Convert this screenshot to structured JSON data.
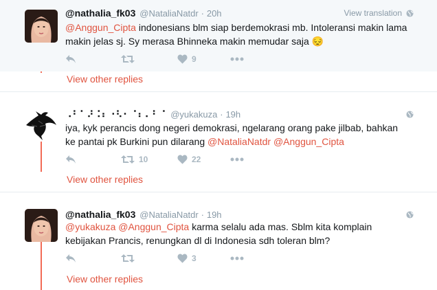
{
  "tweets": [
    {
      "fullname": "@nathalia_fk03",
      "screen_name": "@NataliaNatdr",
      "separator": "·",
      "time": "20h",
      "view_translation": "View translation",
      "text_parts": [
        "@Anggun_Cipta",
        " indonesians blm siap berdemokrasi mb. Intoleransi makin lama",
        "makin jelas sj. Sy merasa Bhinneka makin memudar saja ",
        "😔"
      ],
      "retweets": "",
      "likes": "9",
      "more_replies": "View other replies"
    },
    {
      "fullname": "⠠⠃⠁⠜⠨⠆⠐⠣⠂⠈⠆⠄⠃⠈",
      "screen_name": "@yukakuza",
      "separator": "·",
      "time": "19h",
      "text_line1": "iya, kyk perancis dong negeri demokrasi, ngelarang orang pake jilbab, bahkan",
      "text_line2_plain": "ke pantai pk Burkini pun dilarang ",
      "mention_1": "@NataliaNatdr",
      "mention_2": "@Anggun_Cipta",
      "retweets": "10",
      "likes": "22",
      "more_replies": "View other replies"
    },
    {
      "fullname": "@nathalia_fk03",
      "screen_name": "@NataliaNatdr",
      "separator": "·",
      "time": "19h",
      "mention_1": "@yukakuza",
      "mention_2": "@Anggun_Cipta",
      "text_line1_rest": " karma selalu ada mas. Sblm kita komplain",
      "text_line2": "kebijakan Prancis, renungkan dl di Indonesia sdh toleran blm?",
      "retweets": "",
      "likes": "3",
      "more_replies": "View other replies"
    }
  ],
  "colors": {
    "accent": "#e0533f",
    "thread_line": "#f26a55",
    "muted": "#8899a6",
    "action": "#aab8c2",
    "highlight_bg": "#f5f8fa"
  },
  "icons": [
    "reply-icon",
    "retweet-icon",
    "like-icon",
    "more-icon",
    "globe-icon"
  ]
}
